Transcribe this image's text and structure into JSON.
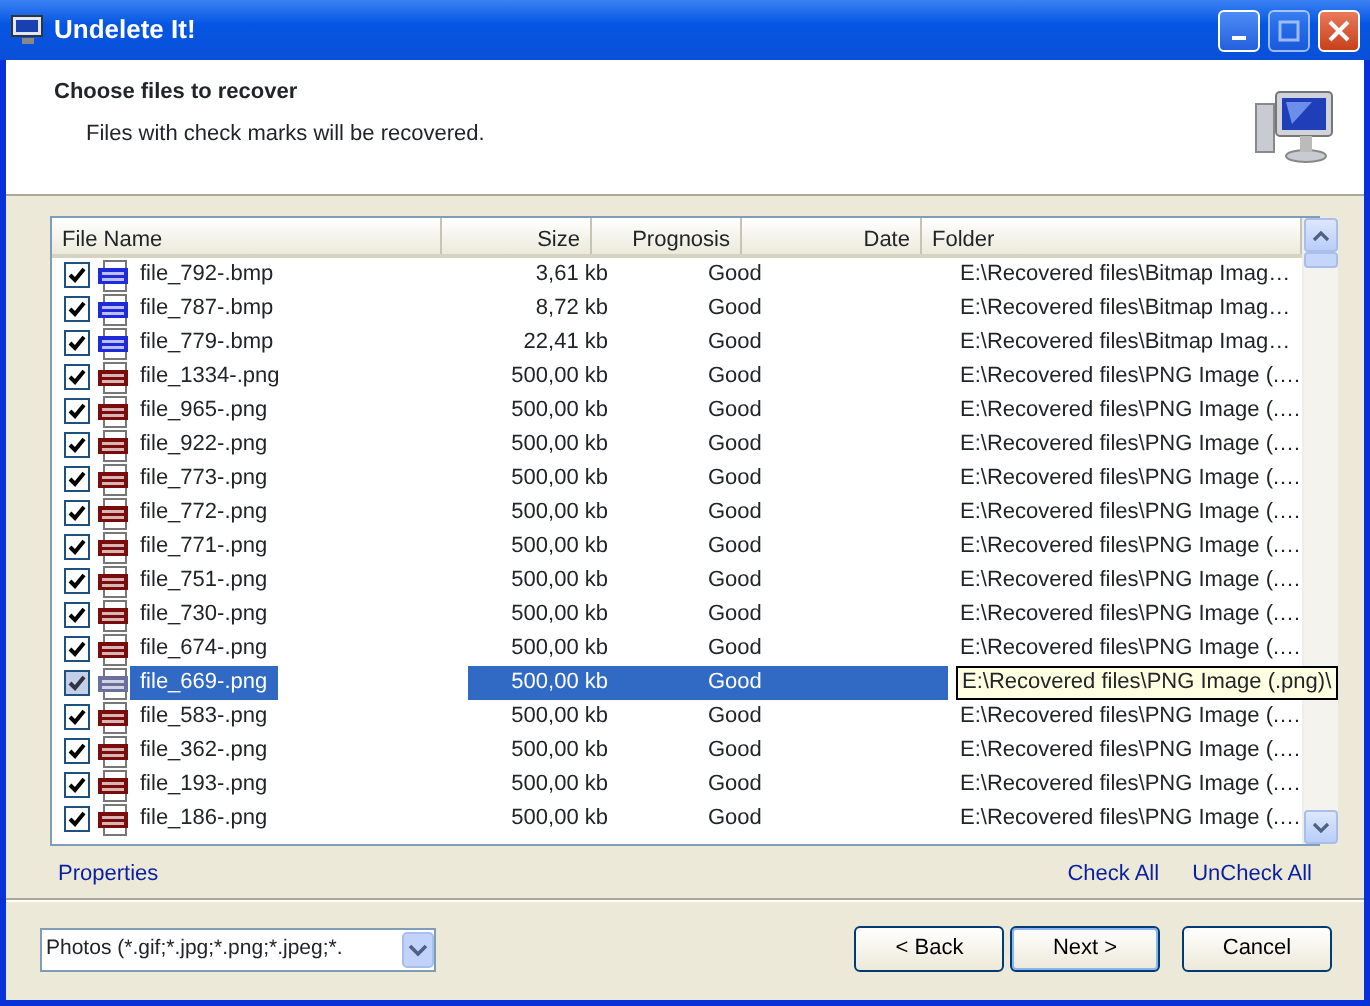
{
  "window": {
    "title": "Undelete It!"
  },
  "header": {
    "title": "Choose files to recover",
    "subtitle": "Files with check marks will be recovered."
  },
  "table": {
    "columns": [
      "File Name",
      "Size",
      "Prognosis",
      "Date",
      "Folder"
    ],
    "rows": [
      {
        "kind": "bmp",
        "name": "file_792-.bmp",
        "size": "3,61 kb",
        "prognosis": "Good",
        "folder": "E:\\Recovered files\\Bitmap Imag…",
        "checked": true,
        "selected": false
      },
      {
        "kind": "bmp",
        "name": "file_787-.bmp",
        "size": "8,72 kb",
        "prognosis": "Good",
        "folder": "E:\\Recovered files\\Bitmap Imag…",
        "checked": true,
        "selected": false
      },
      {
        "kind": "bmp",
        "name": "file_779-.bmp",
        "size": "22,41 kb",
        "prognosis": "Good",
        "folder": "E:\\Recovered files\\Bitmap Imag…",
        "checked": true,
        "selected": false
      },
      {
        "kind": "png",
        "name": "file_1334-.png",
        "size": "500,00 kb",
        "prognosis": "Good",
        "folder": "E:\\Recovered files\\PNG Image (.…",
        "checked": true,
        "selected": false
      },
      {
        "kind": "png",
        "name": "file_965-.png",
        "size": "500,00 kb",
        "prognosis": "Good",
        "folder": "E:\\Recovered files\\PNG Image (.…",
        "checked": true,
        "selected": false
      },
      {
        "kind": "png",
        "name": "file_922-.png",
        "size": "500,00 kb",
        "prognosis": "Good",
        "folder": "E:\\Recovered files\\PNG Image (.…",
        "checked": true,
        "selected": false
      },
      {
        "kind": "png",
        "name": "file_773-.png",
        "size": "500,00 kb",
        "prognosis": "Good",
        "folder": "E:\\Recovered files\\PNG Image (.…",
        "checked": true,
        "selected": false
      },
      {
        "kind": "png",
        "name": "file_772-.png",
        "size": "500,00 kb",
        "prognosis": "Good",
        "folder": "E:\\Recovered files\\PNG Image (.…",
        "checked": true,
        "selected": false
      },
      {
        "kind": "png",
        "name": "file_771-.png",
        "size": "500,00 kb",
        "prognosis": "Good",
        "folder": "E:\\Recovered files\\PNG Image (.…",
        "checked": true,
        "selected": false
      },
      {
        "kind": "png",
        "name": "file_751-.png",
        "size": "500,00 kb",
        "prognosis": "Good",
        "folder": "E:\\Recovered files\\PNG Image (.…",
        "checked": true,
        "selected": false
      },
      {
        "kind": "png",
        "name": "file_730-.png",
        "size": "500,00 kb",
        "prognosis": "Good",
        "folder": "E:\\Recovered files\\PNG Image (.…",
        "checked": true,
        "selected": false
      },
      {
        "kind": "png",
        "name": "file_674-.png",
        "size": "500,00 kb",
        "prognosis": "Good",
        "folder": "E:\\Recovered files\\PNG Image (.…",
        "checked": true,
        "selected": false
      },
      {
        "kind": "png",
        "name": "file_669-.png",
        "size": "500,00 kb",
        "prognosis": "Good",
        "folder": "E:\\Recovered files\\PNG Image (.png)\\",
        "checked": true,
        "selected": true
      },
      {
        "kind": "png",
        "name": "file_583-.png",
        "size": "500,00 kb",
        "prognosis": "Good",
        "folder": "E:\\Recovered files\\PNG Image (.…",
        "checked": true,
        "selected": false
      },
      {
        "kind": "png",
        "name": "file_362-.png",
        "size": "500,00 kb",
        "prognosis": "Good",
        "folder": "E:\\Recovered files\\PNG Image (.…",
        "checked": true,
        "selected": false
      },
      {
        "kind": "png",
        "name": "file_193-.png",
        "size": "500,00 kb",
        "prognosis": "Good",
        "folder": "E:\\Recovered files\\PNG Image (.…",
        "checked": true,
        "selected": false
      },
      {
        "kind": "png",
        "name": "file_186-.png",
        "size": "500,00 kb",
        "prognosis": "Good",
        "folder": "E:\\Recovered files\\PNG Image (.…",
        "checked": true,
        "selected": false
      }
    ]
  },
  "links": {
    "left": "Properties",
    "right": [
      "Check All",
      "UnCheck All"
    ]
  },
  "filter": {
    "value": "Photos (*.gif;*.jpg;*.png;*.jpeg;*."
  },
  "buttons": [
    "< Back",
    "Next >",
    "Cancel"
  ]
}
